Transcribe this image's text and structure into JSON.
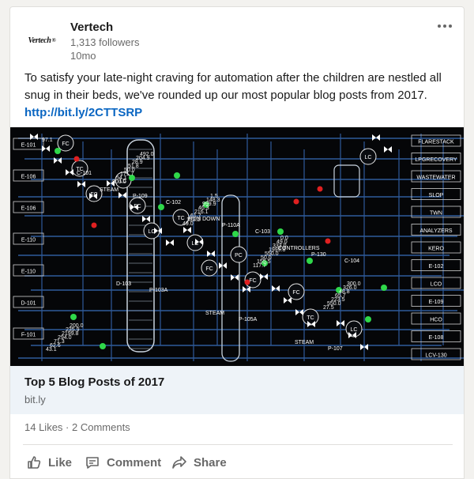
{
  "post": {
    "company": "Vertech",
    "logo_text": "Vertech",
    "logo_mark": "®",
    "followers": "1,313 followers",
    "age": "10mo",
    "text": "To satisfy your late-night craving for automation after the children are nestled all snug in their beds, we've rounded up our most popular blog posts from 2017. ",
    "link": "http://bit.ly/2CTTSRP"
  },
  "link_card": {
    "title": "Top 5 Blog Posts of 2017",
    "domain": "bit.ly"
  },
  "social": {
    "likes": "14 Likes",
    "separator": " · ",
    "comments": "2 Comments"
  },
  "actions": {
    "like": "Like",
    "comment": "Comment",
    "share": "Share"
  },
  "diagram": {
    "right_labels": [
      "FLARESTACK",
      "LPGRECOVERY",
      "WASTEWATER",
      "SLOP",
      "TWN",
      "ANALYZERS",
      "KERO",
      "E-102",
      "LCO",
      "E-109",
      "HCO",
      "E-108",
      "LCV-130"
    ],
    "left_labels": [
      "E-101",
      "E-106",
      "E-106",
      "E-110",
      "E-110",
      "D-101",
      "F-101"
    ],
    "tags": [
      "C-101",
      "C-102",
      "C-103",
      "C-104",
      "P-103A",
      "P-105A",
      "P-107",
      "P-109",
      "P-110A",
      "P-130",
      "D-103",
      "STEAM",
      "STEAM",
      "STEAM",
      "RUN DOWN",
      "CONTROLLERS"
    ],
    "instrument_tags": [
      "FC",
      "LC",
      "TC",
      "PC",
      "FC",
      "LC",
      "TC",
      "FC",
      "LC",
      "FC",
      "TC",
      "LC",
      "FC",
      "LC",
      "FC"
    ],
    "readouts": [
      "97.1",
      "800.0",
      "49.0",
      "117.7",
      "27.5",
      "43.1",
      "54.1",
      "132.2",
      "155.5",
      "550.0",
      "62.6",
      "171.7",
      "61.7",
      "50.0",
      "223.5",
      "71.3",
      "50.0",
      "216.1",
      "550.0",
      "65.7",
      "294.0",
      "51.8",
      "46.3",
      "1999.8",
      "48.8",
      "2199.8",
      "28.9",
      "999.9",
      "333.0",
      "326.0",
      "235.9",
      "204.9",
      "148.3",
      "49.0",
      "300.0",
      "200.0",
      "492.0",
      "1.5",
      "0.0"
    ]
  },
  "colors": {
    "accent": "#0a66c2",
    "image_bg": "#050608",
    "pipe": "#2f5b9a",
    "valve": "#ffffff",
    "instrument": "#2fd84a",
    "alarm": "#e02020"
  }
}
